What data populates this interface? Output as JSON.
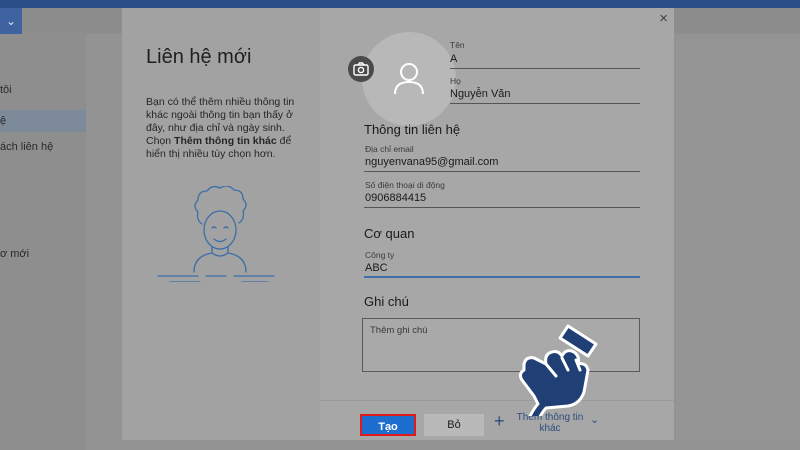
{
  "background": {
    "topbar_chevron": "⌄",
    "sidebar_items": [
      {
        "label": "tôi"
      },
      {
        "label": "ệ"
      },
      {
        "label": "ách liên hệ"
      },
      {
        "label": "ơ mới"
      }
    ]
  },
  "dialog": {
    "title": "Liên hệ mới",
    "description_part1": "Bạn có thể thêm nhiều thông tin khác ngoài thông tin bạn thấy ở đây, như địa chỉ và ngày sinh. Chọn ",
    "description_bold": "Thêm thông tin khác",
    "description_part2": " để hiển thị nhiều tùy chọn hơn.",
    "close_glyph": "×",
    "name": {
      "first_label": "Tên",
      "first_value": "A",
      "last_label": "Họ",
      "last_value": "Nguyễn Văn"
    },
    "contact_section": {
      "title": "Thông tin liên hệ",
      "email_label": "Địa chỉ email",
      "email_value": "nguyenvana95@gmail.com",
      "phone_label": "Số điện thoại di động",
      "phone_value": "0906884415"
    },
    "work_section": {
      "title": "Cơ quan",
      "company_label": "Công ty",
      "company_value": "ABC"
    },
    "notes_section": {
      "title": "Ghi chú",
      "placeholder": "Thêm ghi chú"
    },
    "footer": {
      "create_label": "Tạo",
      "cancel_label": "Bỏ",
      "more_label": "Thêm thông tin khác",
      "more_plus": "+",
      "more_chevron": "⌄"
    }
  },
  "colors": {
    "primary_button": "#1e6ed0",
    "highlight_border": "#e01a1a",
    "focus_underline": "#3f6ea8",
    "pointer_hand": "#1f3f75"
  },
  "icons": {
    "camera": "camera-icon",
    "person": "person-icon",
    "close": "close-icon",
    "plus": "plus-icon",
    "chevron": "chevron-down-icon",
    "pointer": "pointing-hand-icon"
  }
}
